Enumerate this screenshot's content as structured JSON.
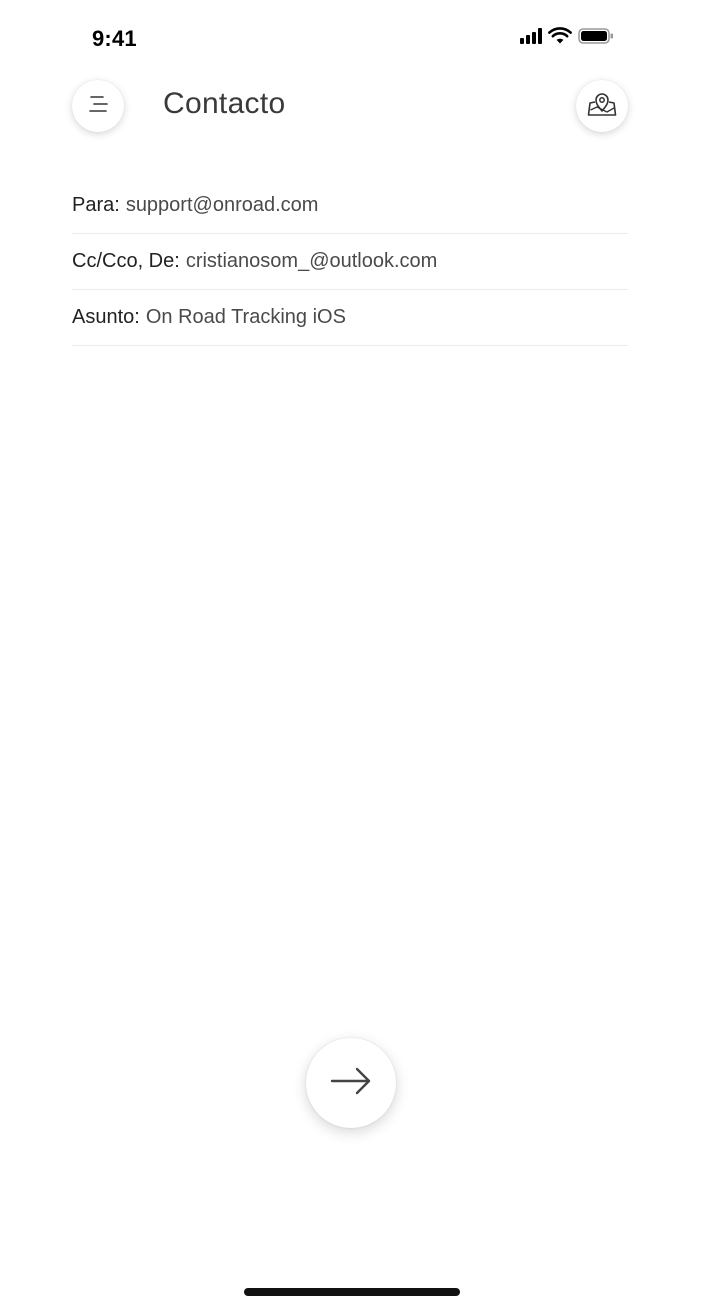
{
  "status_bar": {
    "time": "9:41"
  },
  "header": {
    "title": "Contacto",
    "menu_icon": "hamburger-menu-icon",
    "map_icon": "map-pin-icon"
  },
  "email": {
    "to": {
      "label": "Para:",
      "value": "support@onroad.com"
    },
    "cc_from": {
      "label": "Cc/Cco, De:",
      "value": "cristianosom_@outlook.com"
    },
    "subject": {
      "label": "Asunto:",
      "value": "On Road Tracking iOS"
    }
  },
  "actions": {
    "send_icon": "arrow-right-icon"
  },
  "colors": {
    "background": "#ffffff",
    "text_primary": "#222222",
    "text_secondary": "#4a4a4a",
    "divider": "#ececec"
  }
}
